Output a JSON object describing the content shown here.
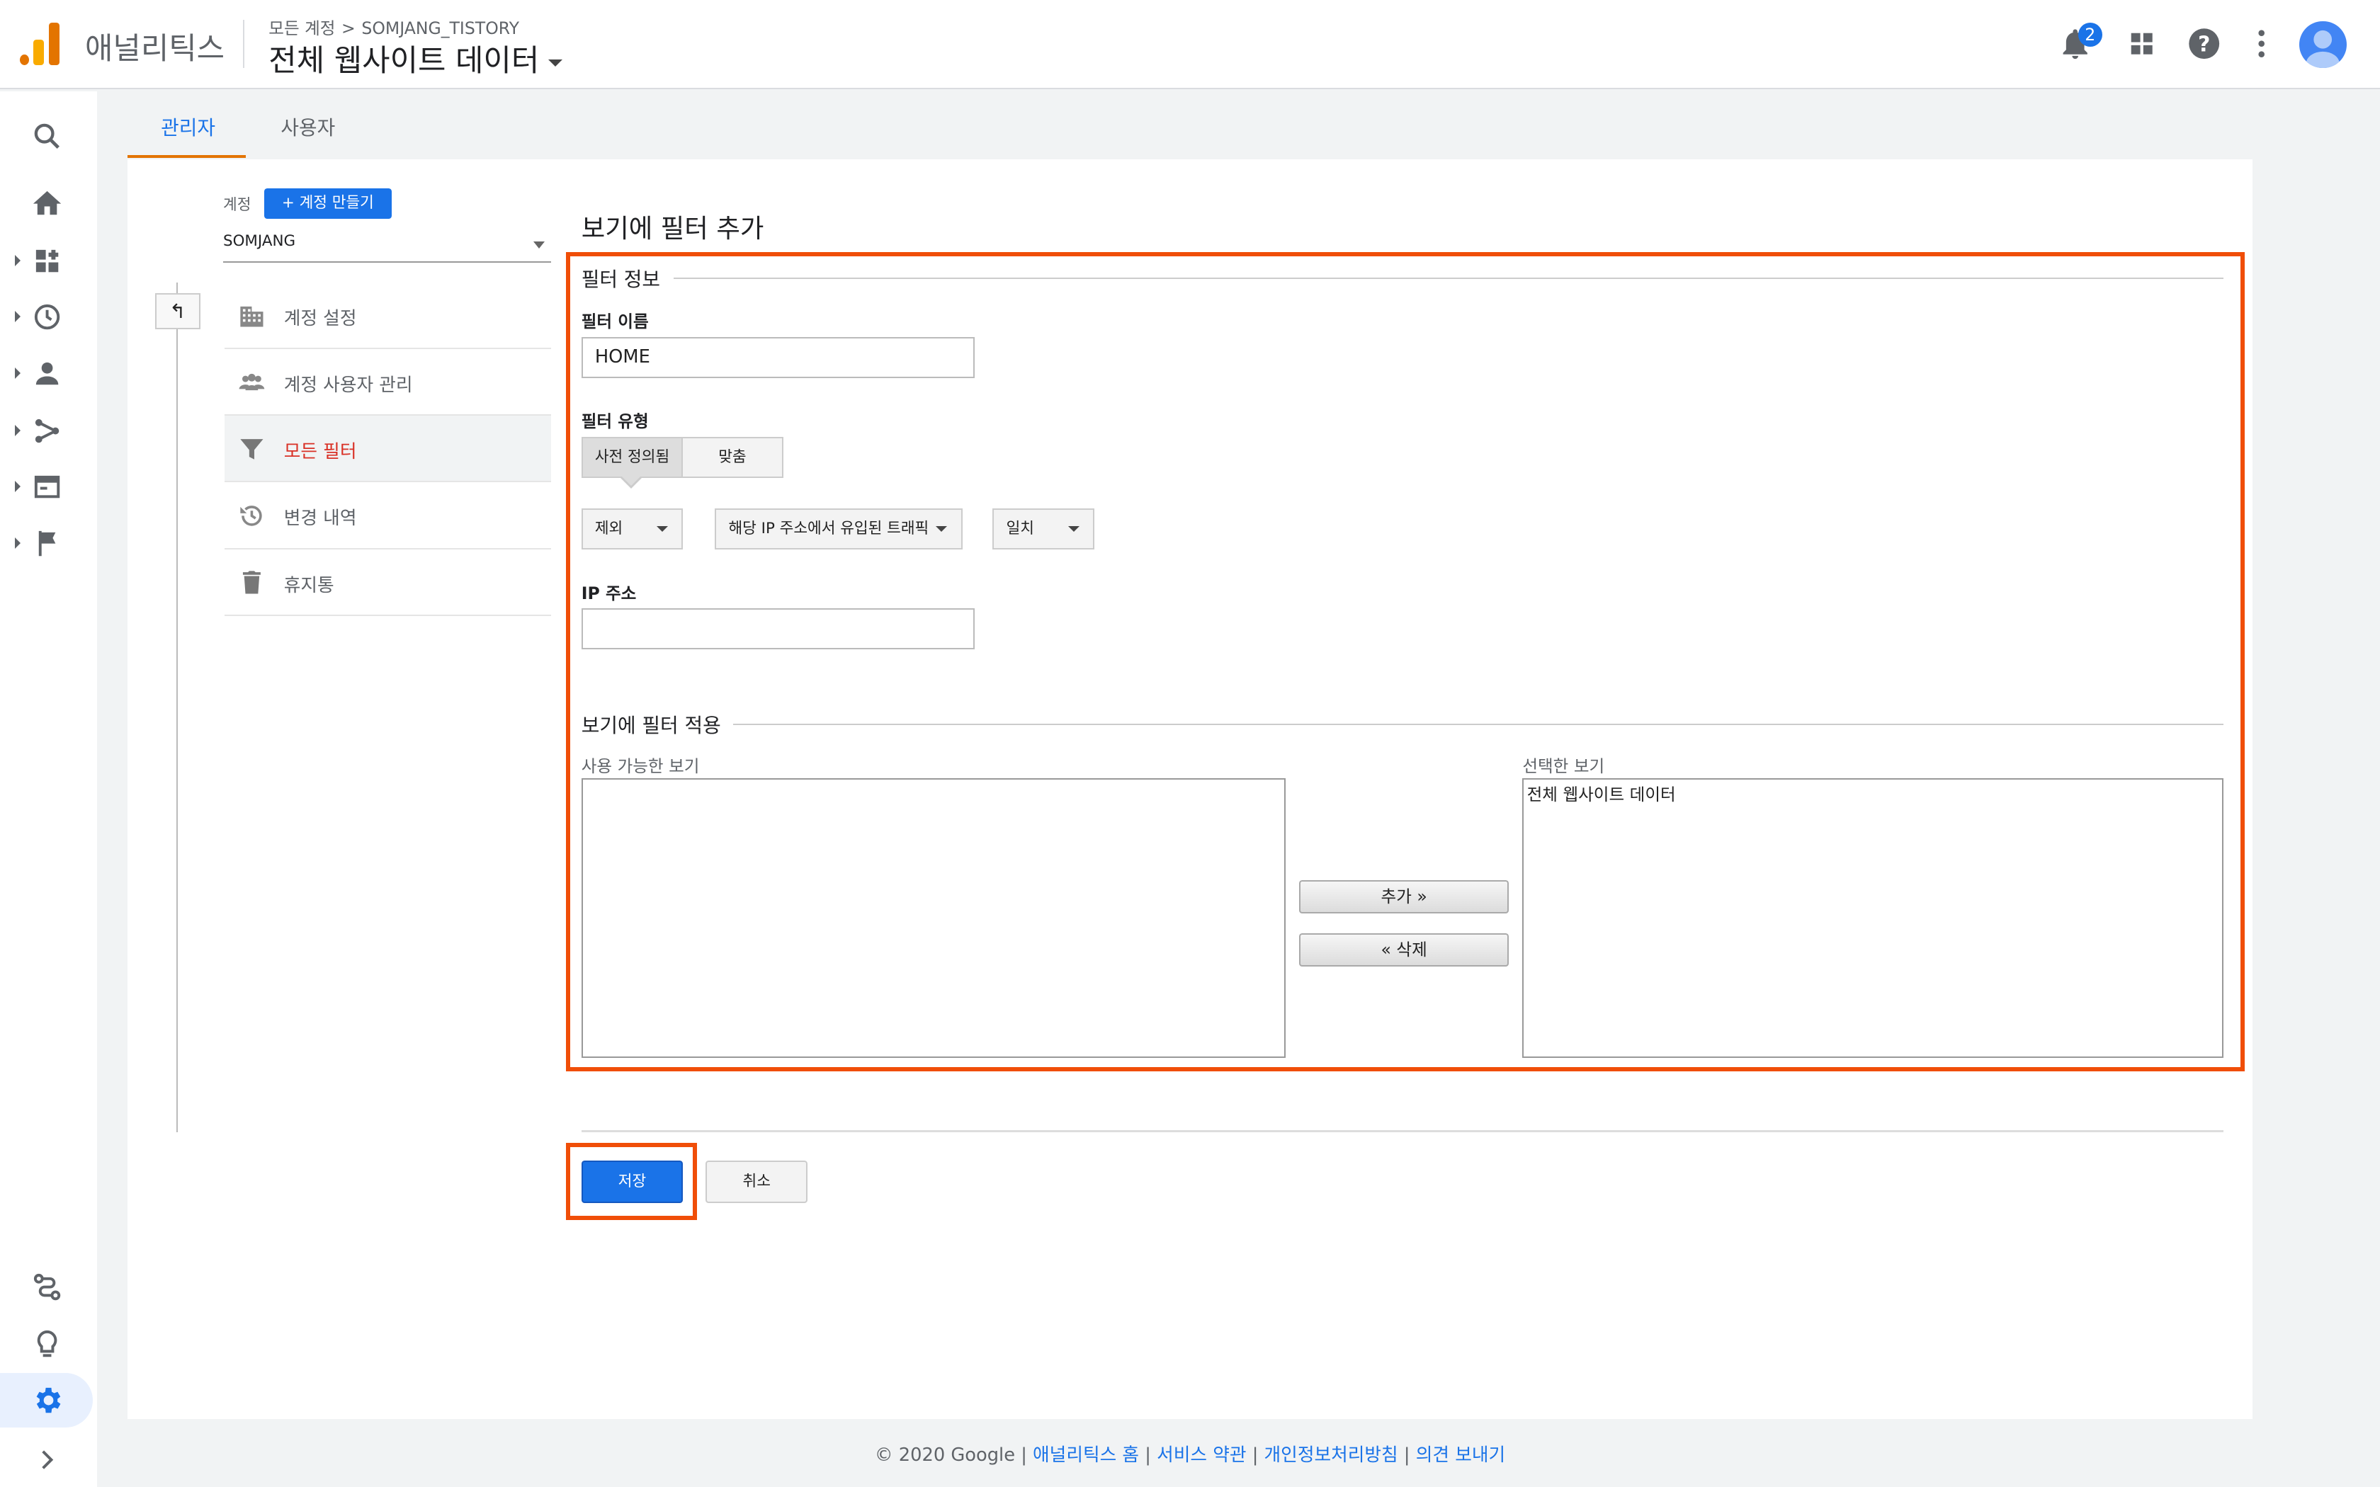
{
  "header": {
    "app_name": "애널리틱스",
    "breadcrumb_parent": "모든 계정",
    "breadcrumb_sep": ">",
    "breadcrumb_account": "SOMJANG_TISTORY",
    "view_title": "전체 웹사이트 데이터",
    "notification_count": "2"
  },
  "tabs": {
    "admin": "관리자",
    "user": "사용자"
  },
  "account_panel": {
    "label": "계정",
    "create_button": "+ 계정 만들기",
    "selected_account": "SOMJANG",
    "menu": [
      {
        "label": "계정 설정",
        "icon": "building-icon"
      },
      {
        "label": "계정 사용자 관리",
        "icon": "people-icon"
      },
      {
        "label": "모든 필터",
        "icon": "filter-icon"
      },
      {
        "label": "변경 내역",
        "icon": "history-icon"
      },
      {
        "label": "휴지통",
        "icon": "trash-icon"
      }
    ]
  },
  "form": {
    "page_title": "보기에 필터 추가",
    "section_info": "필터 정보",
    "filter_name_label": "필터 이름",
    "filter_name_value": "HOME",
    "filter_type_label": "필터 유형",
    "type_predefined": "사전 정의됨",
    "type_custom": "맞춤",
    "dropdown_exclude": "제외",
    "dropdown_source": "해당 IP 주소에서 유입된 트래픽",
    "dropdown_match": "일치",
    "ip_label": "IP 주소",
    "ip_value": "",
    "section_apply": "보기에 필터 적용",
    "available_label": "사용 가능한 보기",
    "selected_label": "선택한 보기",
    "selected_items": [
      "전체 웹사이트 데이터"
    ],
    "add_button": "추가 »",
    "remove_button": "« 삭제",
    "save_button": "저장",
    "cancel_button": "취소"
  },
  "footer": {
    "copyright": "© 2020 Google",
    "sep": "|",
    "link_home": "애널리틱스 홈",
    "link_terms": "서비스 약관",
    "link_privacy": "개인정보처리방침",
    "link_feedback": "의견 보내기"
  },
  "colors": {
    "accent": "#1a73e8",
    "highlight": "#f04e08",
    "tab_underline": "#e37400",
    "active_menu": "#d93025"
  }
}
